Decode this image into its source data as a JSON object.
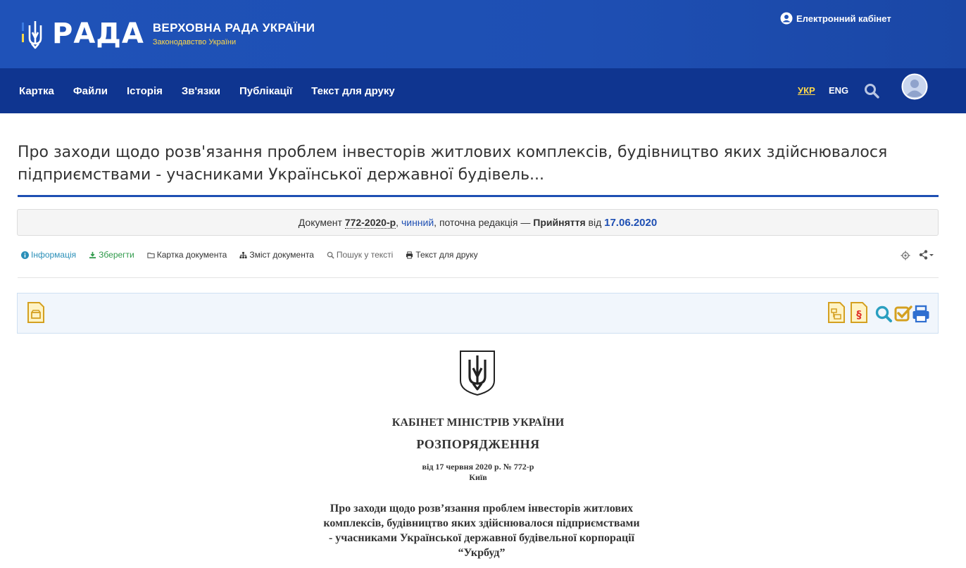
{
  "header": {
    "logo_word": "РАДА",
    "title": "ВЕРХОВНА РАДА УКРАЇНИ",
    "subtitle": "Законодавство України",
    "cabinet_label": "Електронний кабінет"
  },
  "nav": {
    "items": [
      {
        "label": "Картка"
      },
      {
        "label": "Файли"
      },
      {
        "label": "Історія"
      },
      {
        "label": "Зв'язки"
      },
      {
        "label": "Публікації"
      },
      {
        "label": "Текст для друку"
      }
    ],
    "lang_ukr": "УКР",
    "lang_eng": "ENG"
  },
  "page": {
    "title_line1": "Про заходи щодо розв'язання проблем інвесторів житлових комплексів, будівництво яких здійснювалося",
    "title_line2": "підприємствами - учасниками Української державної будівель..."
  },
  "docbox": {
    "prefix": "Документ",
    "number": "772-2020-р",
    "comma": ",",
    "status": "чинний",
    "middle": ", поточна редакція —",
    "stage": "Прийняття",
    "from": "від",
    "date": "17.06.2020"
  },
  "toolbar": {
    "info": "Інформація",
    "save": "Зберегти",
    "card": "Картка документа",
    "contents": "Зміст документа",
    "search": "Пошук у тексті",
    "print": "Текст для друку"
  },
  "document": {
    "org": "КАБІНЕТ МІНІСТРІВ УКРАЇНИ",
    "kind": "РОЗПОРЯДЖЕННЯ",
    "date_line": "від 17 червня 2020 р. № 772-р",
    "city": "Київ",
    "subject_lines": [
      "Про заходи щодо розв’язання проблем інвесторів житлових",
      "комплексів, будівництво яких здійснювалося підприємствами",
      "- учасниками Української державної будівельної корпорації",
      "“Укрбуд”"
    ]
  },
  "colors": {
    "header_blue": "#1f52b8",
    "nav_blue": "#0f3590",
    "accent_yellow": "#ffd94a",
    "link_blue": "#1e4fb3"
  }
}
